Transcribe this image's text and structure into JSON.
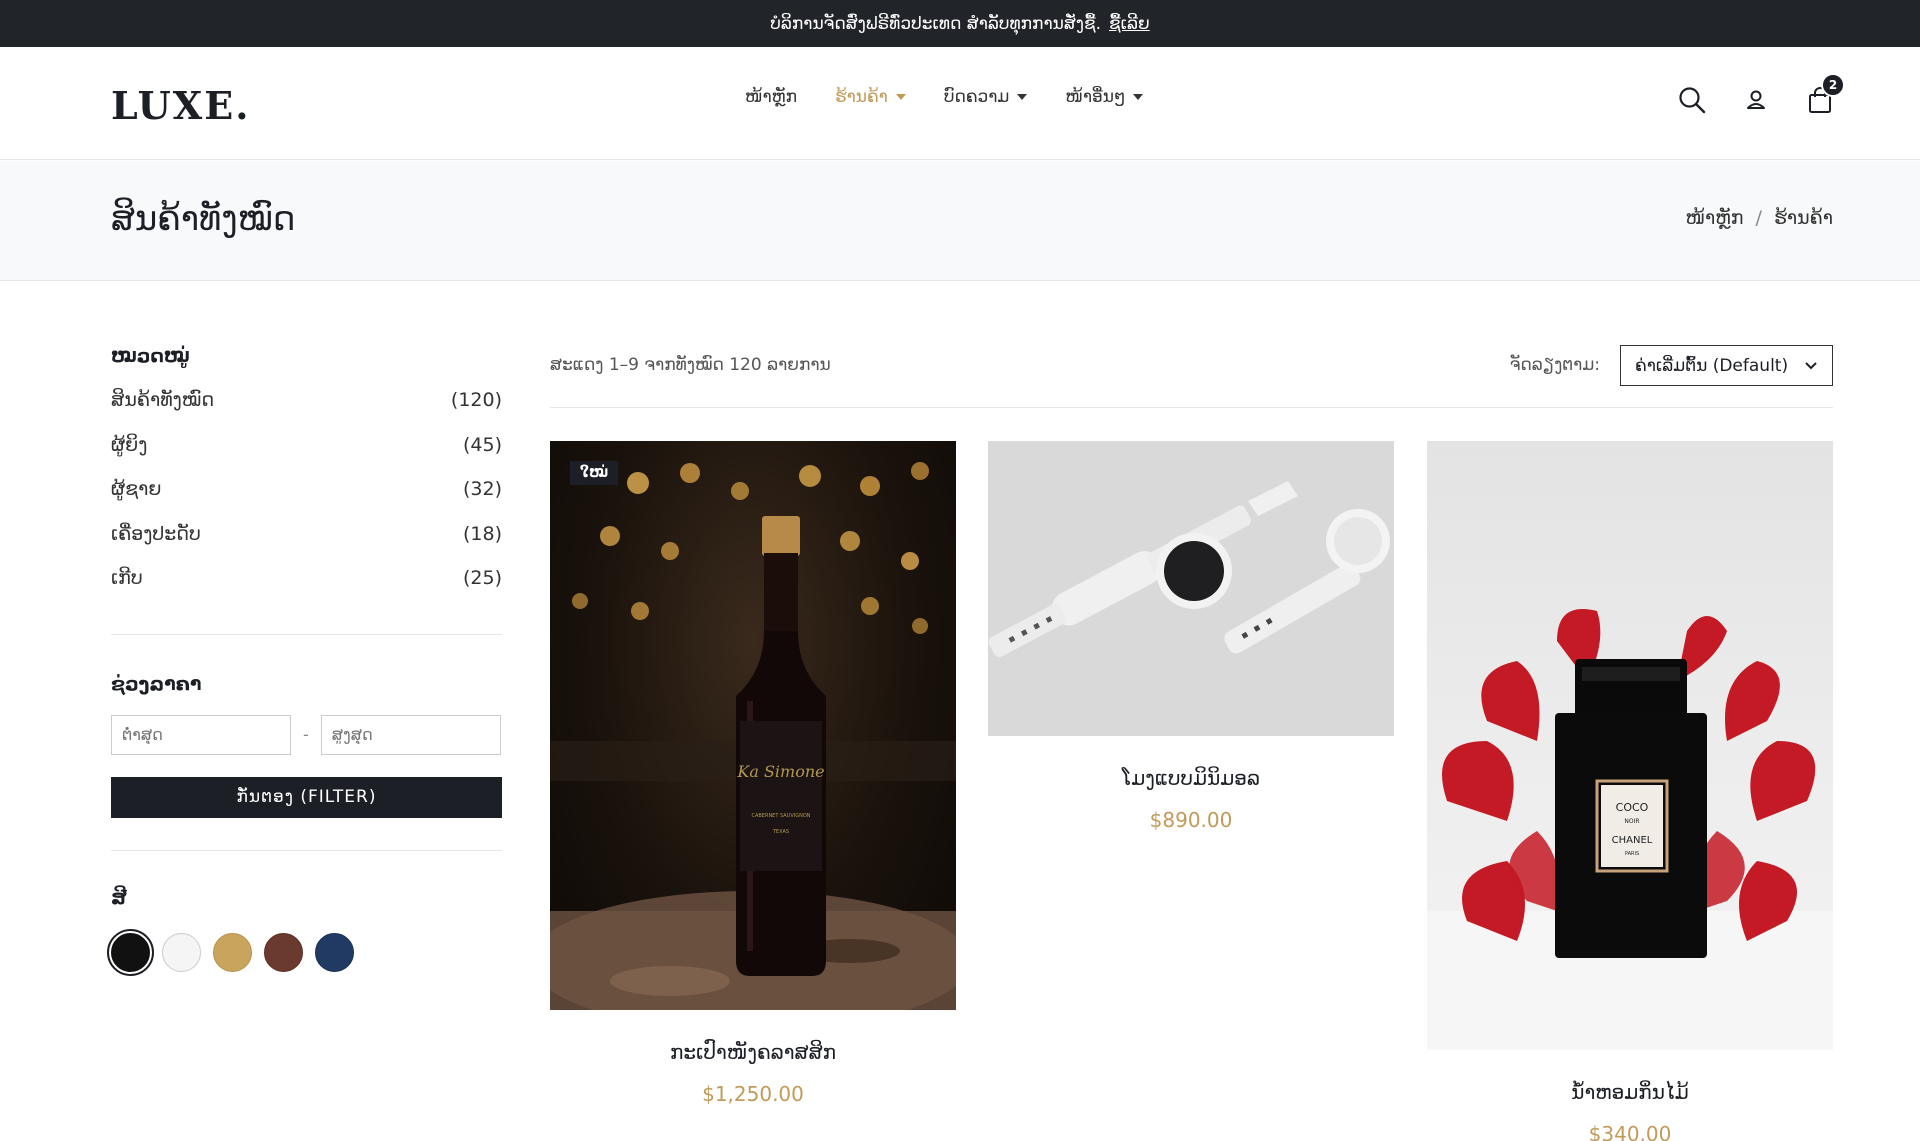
{
  "announcement": {
    "text": "ບໍລິການຈັດສົ່ງຟຣີທົ່ວປະເທດ ສຳລັບທຸກການສັ່ງຊື້.",
    "link_label": "ຊື້ເລີຍ"
  },
  "logo": "LUXE.",
  "nav": [
    {
      "label": "ໜ້າຫຼັກ",
      "has_dropdown": false,
      "active": false
    },
    {
      "label": "ຮ້ານຄ້າ",
      "has_dropdown": true,
      "active": true
    },
    {
      "label": "ບົດຄວາມ",
      "has_dropdown": true,
      "active": false
    },
    {
      "label": "ໜ້າອື່ນໆ",
      "has_dropdown": true,
      "active": false
    }
  ],
  "header_icons": {
    "search": "search-icon",
    "account": "user-icon",
    "cart": "shopping-bag-icon",
    "cart_count": "2"
  },
  "page": {
    "title": "ສິນຄ້າທັງໝົດ",
    "breadcrumb": [
      "ໜ້າຫຼັກ",
      "ຮ້ານຄ້າ"
    ],
    "breadcrumb_sep": "/"
  },
  "sidebar": {
    "categories_heading": "ໝວດໝູ່",
    "categories": [
      {
        "label": "ສິນຄ້າທັງໝົດ",
        "count": "(120)"
      },
      {
        "label": "ຜູ້ຍິງ",
        "count": "(45)"
      },
      {
        "label": "ຜູ້ຊາຍ",
        "count": "(32)"
      },
      {
        "label": "ເຄື່ອງປະດັບ",
        "count": "(18)"
      },
      {
        "label": "ເກີບ",
        "count": "(25)"
      }
    ],
    "price_heading": "ຊ່ວງລາຄາ",
    "price_min_placeholder": "ຕ່ຳສຸດ",
    "price_max_placeholder": "ສູງສຸດ",
    "price_dash": "-",
    "filter_label": "ກັ່ນຕອງ (FILTER)",
    "color_heading": "ສີ",
    "colors": [
      "#111111",
      "#f5f5f5",
      "#c9a45c",
      "#6b3a2e",
      "#213a63"
    ]
  },
  "toolbar": {
    "result_text": "ສະແດງ 1–9 ຈາກທັງໝົດ 120 ລາຍການ",
    "sort_label": "ຈັດລຽງຕາມ:",
    "sort_value": "ຄ່າເລີ່ມຕົ້ນ (Default)"
  },
  "products": [
    {
      "name": "ກະເປົາໜັງຄລາສສິກ",
      "price": "$1,250.00",
      "badge": "ໃໝ່"
    },
    {
      "name": "ໂມງແບບມິນິມອລ",
      "price": "$890.00"
    },
    {
      "name": "ນ້ຳຫອມກິ່ນໄມ້",
      "price": "$340.00"
    }
  ],
  "product_image_text": {
    "wine_label": "Ka Simone",
    "wine_sub": "CABERNET SAUVIGNON",
    "wine_region": "TEXAS",
    "perfume_brand_top": "COCO",
    "perfume_brand_mid": "NOIR",
    "perfume_brand_name": "CHANEL",
    "perfume_brand_city": "PARIS"
  },
  "colors": {
    "accent": "#c29a59",
    "dark": "#1c1f26",
    "topbar": "#212529",
    "band": "#f8f9fa"
  }
}
